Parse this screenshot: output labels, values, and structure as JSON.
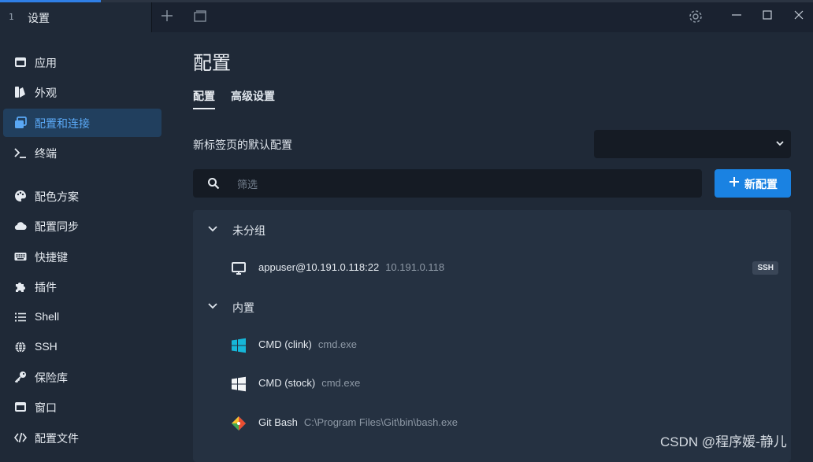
{
  "tab": {
    "index": "1",
    "title": "设置"
  },
  "sidebar": {
    "items": [
      {
        "label": "应用",
        "icon": "app-window-icon"
      },
      {
        "label": "外观",
        "icon": "appearance-icon"
      },
      {
        "label": "配置和连接",
        "icon": "profiles-icon",
        "active": true
      },
      {
        "label": "终端",
        "icon": "terminal-icon"
      },
      {
        "label": "配色方案",
        "icon": "palette-icon"
      },
      {
        "label": "配置同步",
        "icon": "cloud-icon"
      },
      {
        "label": "快捷键",
        "icon": "keyboard-icon"
      },
      {
        "label": "插件",
        "icon": "puzzle-icon"
      },
      {
        "label": "Shell",
        "icon": "list-icon"
      },
      {
        "label": "SSH",
        "icon": "globe-icon"
      },
      {
        "label": "保险库",
        "icon": "key-icon"
      },
      {
        "label": "窗口",
        "icon": "window-icon"
      },
      {
        "label": "配置文件",
        "icon": "code-icon"
      }
    ]
  },
  "main": {
    "title": "配置",
    "tabs": [
      {
        "label": "配置",
        "active": true
      },
      {
        "label": "高级设置"
      }
    ],
    "default_profile_label": "新标签页的默认配置",
    "default_profile_value": "",
    "filter_placeholder": "筛选",
    "new_profile_label": "新配置",
    "groups": [
      {
        "name": "未分组",
        "profiles": [
          {
            "name": "appuser@10.191.0.118:22",
            "desc": "10.191.0.118",
            "icon": "monitor-icon",
            "badge": "SSH"
          }
        ]
      },
      {
        "name": "内置",
        "profiles": [
          {
            "name": "CMD (clink)",
            "desc": "cmd.exe",
            "icon": "windows-logo-icon-color"
          },
          {
            "name": "CMD (stock)",
            "desc": "cmd.exe",
            "icon": "windows-logo-icon-white"
          },
          {
            "name": "Git Bash",
            "desc": "C:\\Program Files\\Git\\bin\\bash.exe",
            "icon": "git-icon"
          }
        ]
      }
    ]
  },
  "watermark": "CSDN @程序媛-静儿",
  "colors": {
    "accent": "#1a82e2",
    "active_nav_bg": "#213f5e",
    "active_nav_text": "#5aa8f5",
    "background": "#1f2937"
  }
}
